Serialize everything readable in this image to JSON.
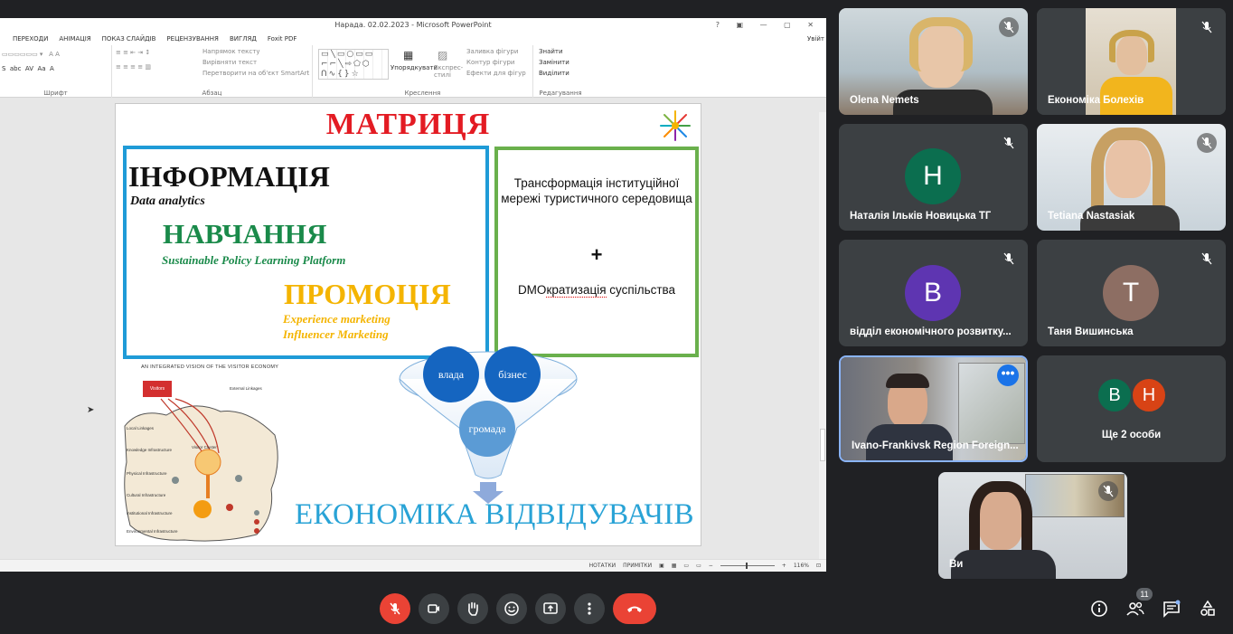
{
  "app": {
    "window_title": "Нарада. 02.02.2023 - Microsoft PowerPoint",
    "signin": "Увійт",
    "tabs": [
      "ПЕРЕХОДИ",
      "АНІМАЦІЯ",
      "ПОКАЗ СЛАЙДІВ",
      "РЕЦЕНЗУВАННЯ",
      "ВИГЛЯД",
      "Foxit PDF"
    ],
    "ribbon": {
      "font_group": "Шрифт",
      "paragraph_group": "Абзац",
      "paragraph_items": [
        "Напрямок тексту",
        "Вирівняти текст",
        "Перетворити на об'єкт SmartArt"
      ],
      "drawing_group": "Креслення",
      "arrange": "Упорядкувати",
      "quick_styles": "Експрес-стилі",
      "shape_items": [
        "Заливка фігури",
        "Контур фігури",
        "Ефекти для фігур"
      ],
      "editing_group": "Редагування",
      "editing_items": [
        "Знайти",
        "Замінити",
        "Виділити"
      ]
    },
    "status": {
      "notes": "НОТАТКИ",
      "comments": "ПРИМІТКИ",
      "zoom": "116%"
    }
  },
  "slide": {
    "title": "МАТРИЦЯ",
    "info_heading": "ІНФОРМАЦІЯ",
    "info_sub": "Data analytics",
    "learn_heading": "НАВЧАННЯ",
    "learn_sub": "Sustainable Policy Learning Platform",
    "promo_heading": "ПРОМОЦІЯ",
    "promo_sub1": "Experience marketing",
    "promo_sub2": "Influencer Marketing",
    "green_text1": "Трансформація інституційної мережі туристичного середовища",
    "green_plus": "+",
    "green_text2_a": "DMO",
    "green_text2_b": "кратизація",
    "green_text2_c": " суспільства",
    "circle_vlada": "влада",
    "circle_biz": "бізнес",
    "circle_gromada": "громада",
    "bottom_text": "ЕКОНОМІКА ВІДВІДУВАЧІВ",
    "mini_title": "AN INTEGRATED VISION OF THE VISITOR ECONOMY",
    "mini_visitor": "Visitors",
    "mini_labels": [
      "Local Linkages",
      "Knowledge Infrastructure",
      "Physical Infrastructure",
      "Cultural Infrastructure",
      "Institutional Infrastructure",
      "Environmental Infrastructure",
      "External Linkages",
      "Visitor Cluster"
    ]
  },
  "participants": [
    {
      "name": "Olena Nemets",
      "type": "video"
    },
    {
      "name": "Економіка Болехів",
      "type": "video"
    },
    {
      "name": "Наталія Ільків Новицька ТГ",
      "type": "avatar",
      "initial": "Н",
      "color": "#0b6e4f"
    },
    {
      "name": "Tetiana Nastasiak",
      "type": "video"
    },
    {
      "name": "відділ економічного розвитку...",
      "type": "avatar",
      "initial": "В",
      "color": "#5e35b1"
    },
    {
      "name": "Таня Вишинська",
      "type": "avatar",
      "initial": "Т",
      "color": "#8d6e63"
    },
    {
      "name": "Ivano-Frankivsk Region Foreign...",
      "type": "video"
    },
    {
      "name": "Ще 2 особи",
      "type": "group",
      "initials": [
        "В",
        "Н"
      ],
      "colors": [
        "#0b6e4f",
        "#d84315"
      ]
    },
    {
      "name": "Ви",
      "type": "video"
    }
  ],
  "controls": {
    "participants_count": "11",
    "icons": [
      "mic-off-icon",
      "camera-icon",
      "raise-hand-icon",
      "emoji-icon",
      "present-icon",
      "more-options-icon",
      "end-call-icon",
      "info-icon",
      "people-icon",
      "chat-icon",
      "activities-icon"
    ]
  },
  "colors": {
    "accent": "#1a73e8",
    "danger": "#ea4335",
    "bg": "#202124",
    "tile": "#3c4043"
  }
}
